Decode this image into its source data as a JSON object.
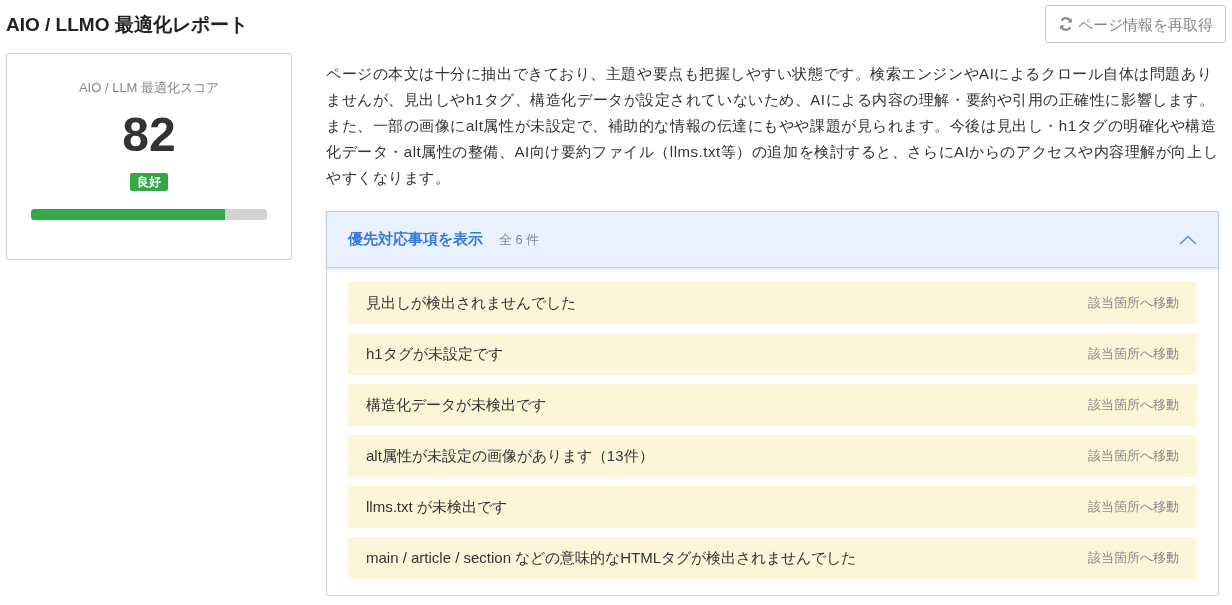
{
  "header": {
    "title": "AIO / LLMO 最適化レポート",
    "refresh_button": "ページ情報を再取得"
  },
  "score_card": {
    "label": "AIO / LLM 最適化スコア",
    "score": "82",
    "rating": "良好",
    "level": 0.82
  },
  "summary": "ページの本文は十分に抽出できており、主題や要点も把握しやすい状態です。検索エンジンやAIによるクロール自体は問題ありませんが、見出しやh1タグ、構造化データが設定されていないため、AIによる内容の理解・要約や引用の正確性に影響します。また、一部の画像にalt属性が未設定で、補助的な情報の伝達にもやや課題が見られます。今後は見出し・h1タグの明確化や構造化データ・alt属性の整備、AI向け要約ファイル（llms.txt等）の追加を検討すると、さらにAIからのアクセスや内容理解が向上しやすくなります。",
  "priority_panel": {
    "title": "優先対応事項を表示",
    "count": "全 6 件",
    "expanded": true,
    "items": [
      {
        "text": "見出しが検出されませんでした",
        "link": "該当箇所へ移動"
      },
      {
        "text": "h1タグが未設定です",
        "link": "該当箇所へ移動"
      },
      {
        "text": "構造化データが未検出です",
        "link": "該当箇所へ移動"
      },
      {
        "text": "alt属性が未設定の画像があります（13件）",
        "link": "該当箇所へ移動"
      },
      {
        "text": "llms.txt が未検出です",
        "link": "該当箇所へ移動"
      },
      {
        "text": "main / article / section などの意味的なHTMLタグが検出されませんでした",
        "link": "該当箇所へ移動"
      }
    ]
  }
}
